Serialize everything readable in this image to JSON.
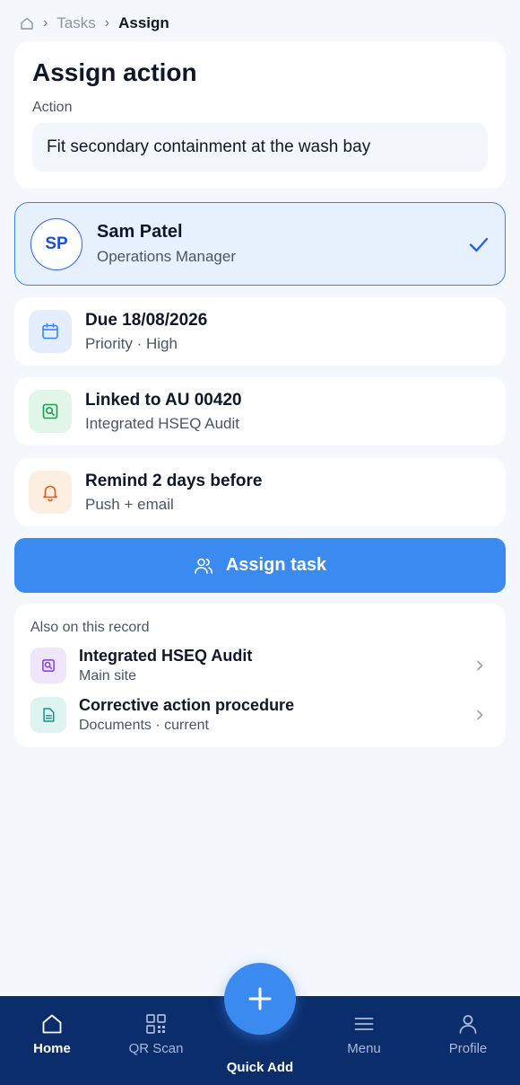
{
  "breadcrumb": {
    "items": [
      "Tasks"
    ],
    "current": "Assign"
  },
  "action_card": {
    "title": "Assign action",
    "label": "Action",
    "value": "Fit secondary containment at the wash bay"
  },
  "assignee": {
    "initials": "SP",
    "name": "Sam Patel",
    "role": "Operations Manager",
    "selected": true
  },
  "details": [
    {
      "title": "Due 18/08/2026",
      "subtitle": "Priority · High",
      "icon": "calendar-icon",
      "color": "#3b82f6"
    },
    {
      "title": "Linked to AU 00420",
      "subtitle": "Integrated HSEQ Audit",
      "icon": "audit-search-icon",
      "color": "#16a34a"
    },
    {
      "title": "Remind 2 days before",
      "subtitle": "Push + email",
      "icon": "bell-icon",
      "color": "#ea580c"
    }
  ],
  "assign_button": {
    "label": "Assign task"
  },
  "record": {
    "header": "Also on this record",
    "items": [
      {
        "title": "Integrated HSEQ Audit",
        "subtitle": "Main site",
        "icon": "audit-search-icon",
        "color": "#7c3aed"
      },
      {
        "title": "Corrective action procedure",
        "subtitle": "Documents · current",
        "icon": "document-icon",
        "color": "#0d9488"
      }
    ]
  },
  "nav": {
    "home": "Home",
    "qr": "QR Scan",
    "quick_add": "Quick Add",
    "menu": "Menu",
    "profile": "Profile"
  },
  "colors": {
    "accent": "#3b8af0",
    "nav_bg": "#0c2d6b",
    "page_bg": "#f4f7fc"
  }
}
